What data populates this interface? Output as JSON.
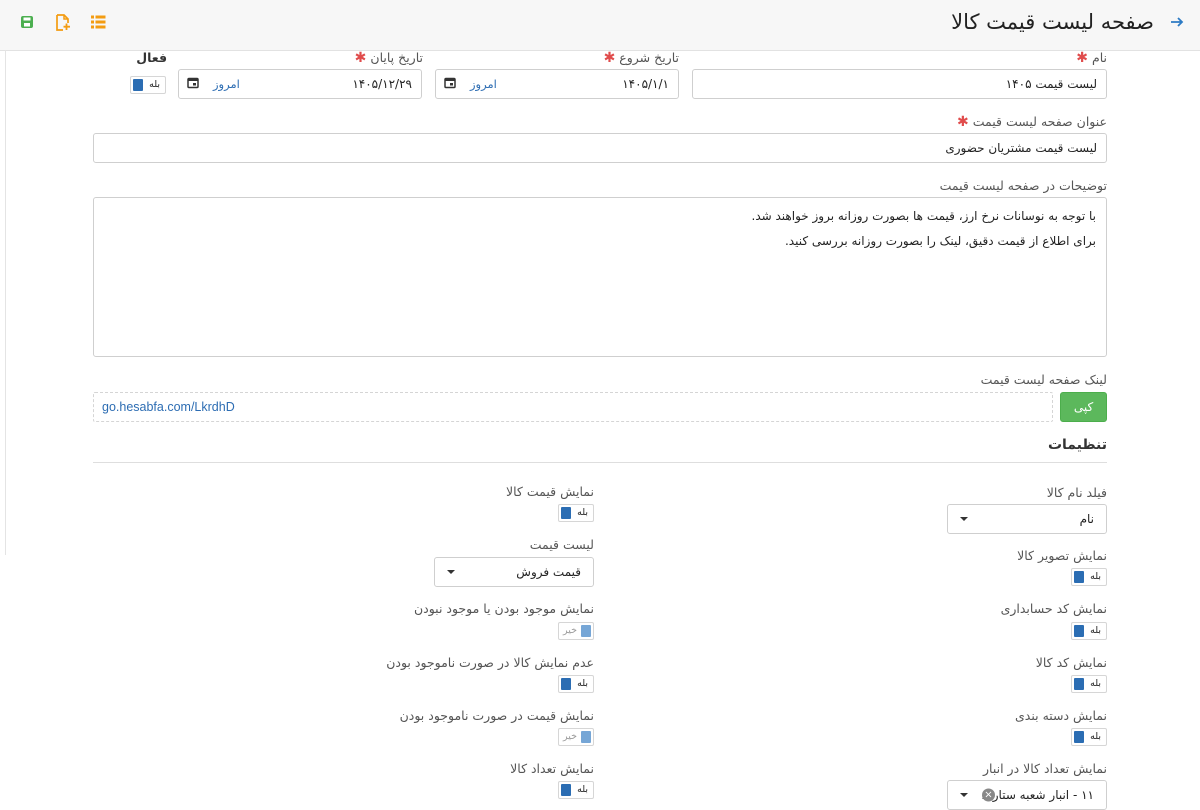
{
  "header": {
    "title": "صفحه لیست قیمت کالا",
    "back_icon": "arrow-right-icon",
    "toolbar_icons": [
      "save-icon",
      "add-file-icon",
      "list-icon"
    ],
    "toolbar_colors": [
      "#4caf50",
      "#f39c12",
      "#f39c12"
    ]
  },
  "form": {
    "name_label": "نام",
    "name_value": "لیست قیمت ۱۴۰۵",
    "start_label": "تاریخ شروع",
    "start_value": "۱۴۰۵/۱/۱",
    "start_today": "امروز",
    "end_label": "تاریخ پایان",
    "end_value": "۱۴۰۵/۱۲/۲۹",
    "end_today": "امروز",
    "active_label": "فعال",
    "active_toggle": "بله",
    "page_title_label": "عنوان صفحه لیست قیمت",
    "page_title_value": "لیست قیمت مشتریان حضوری",
    "desc_label": "توضیحات در صفحه لیست قیمت",
    "desc_line1": "با توجه به نوسانات نرخ ارز، قیمت ها بصورت روزانه بروز خواهند شد.",
    "desc_line2": "برای اطلاع از قیمت دقیق، لینک را بصورت روزانه بررسی کنید.",
    "link_label": "لینک صفحه لیست قیمت",
    "copy_label": "کپی",
    "link_value": "go.hesabfa.com/LkrdhD",
    "required_mark": "✱"
  },
  "settings": {
    "heading": "تنظیمات",
    "name_field_label": "فیلد نام کالا",
    "name_field_value": "نام",
    "show_image_label": "نمایش تصویر کالا",
    "show_image_toggle": "بله",
    "show_acc_code_label": "نمایش کد حسابداری",
    "show_acc_code_toggle": "بله",
    "show_code_label": "نمایش کد کالا",
    "show_code_toggle": "بله",
    "show_category_label": "نمایش دسته بندی",
    "show_category_toggle": "بله",
    "show_stock_label": "نمایش تعداد کالا در انبار",
    "warehouse_value": "۱۱ - انبار شعبه ستار...",
    "show_price_label": "نمایش قیمت کالا",
    "show_price_toggle": "بله",
    "price_list_label": "لیست قیمت",
    "price_list_value": "قیمت فروش",
    "show_availability_label": "نمایش موجود بودن یا موجود نبودن",
    "show_availability_toggle": "خیر",
    "hide_unavailable_label": "عدم نمایش کالا در صورت ناموجود بودن",
    "hide_unavailable_toggle": "بله",
    "show_price_unavailable_label": "نمایش قیمت در صورت ناموجود بودن",
    "show_price_unavailable_toggle": "خیر",
    "show_quantity_label": "نمایش تعداد کالا",
    "show_quantity_toggle": "بله"
  }
}
